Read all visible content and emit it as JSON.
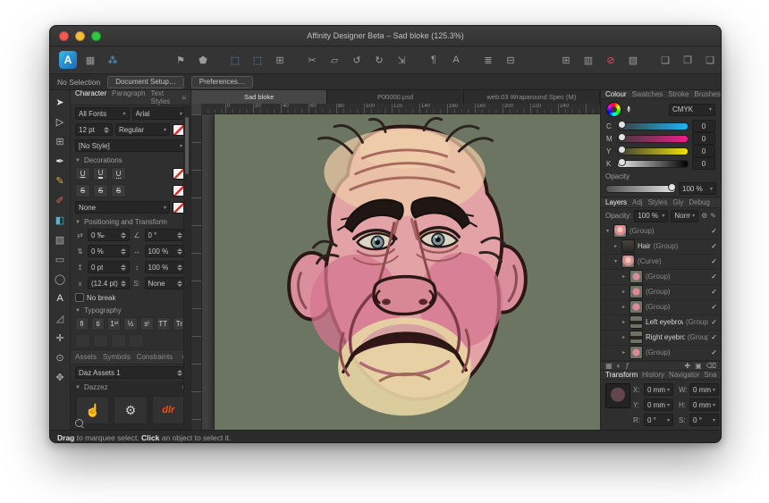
{
  "window": {
    "title": "Affinity Designer Beta – Sad bloke (125.3%)",
    "traffic": [
      "#f45c53",
      "#f6bd3b",
      "#2fc742"
    ]
  },
  "toolbar": {
    "groups": [
      {
        "icons": [
          {
            "name": "affinity-designer-logo",
            "glyph": "A",
            "logo": true
          },
          {
            "name": "pixel-persona-icon",
            "glyph": "▦",
            "color": "#9c9c9c"
          },
          {
            "name": "export-persona-icon",
            "glyph": "⁂",
            "color": "#57a8d8"
          }
        ]
      },
      {
        "icons": [
          {
            "name": "place-image-icon",
            "glyph": "⚑",
            "color": "#9c9c9c"
          },
          {
            "name": "shape-builder-icon",
            "glyph": "⬟",
            "color": "#9c9c9c"
          }
        ]
      },
      {
        "icons": [
          {
            "name": "marquee-select-icon",
            "glyph": "⬚",
            "color": "#6aa7e0"
          },
          {
            "name": "snap-to-grid-icon",
            "glyph": "⬚",
            "color": "#6aa7e0"
          },
          {
            "name": "grid-options-icon",
            "glyph": "⊞",
            "color": "#9c9c9c"
          }
        ]
      },
      {
        "icons": [
          {
            "name": "cut-icon",
            "glyph": "✂",
            "color": "#9c9c9c"
          },
          {
            "name": "duplicate-icon",
            "glyph": "▱",
            "color": "#9c9c9c"
          },
          {
            "name": "undo-icon",
            "glyph": "↺",
            "color": "#9c9c9c"
          },
          {
            "name": "redo-icon",
            "glyph": "↻",
            "color": "#9c9c9c"
          },
          {
            "name": "transform-icon",
            "glyph": "⇲",
            "color": "#9c9c9c"
          }
        ]
      },
      {
        "icons": [
          {
            "name": "paragraph-marks-icon",
            "glyph": "¶",
            "color": "#9c9c9c"
          },
          {
            "name": "character-traits-icon",
            "glyph": "A",
            "color": "#9c9c9c"
          }
        ]
      },
      {
        "icons": [
          {
            "name": "alignment-icon",
            "glyph": "≣",
            "color": "#9c9c9c"
          },
          {
            "name": "distribute-icon",
            "glyph": "⊟",
            "color": "#9c9c9c"
          }
        ]
      },
      {
        "icons": [
          {
            "name": "grid-icon",
            "glyph": "⊞",
            "color": "#9c9c9c"
          },
          {
            "name": "guides-icon",
            "glyph": "▥",
            "color": "#9c9c9c"
          },
          {
            "name": "snapping-icon",
            "glyph": "⊘",
            "color": "#e14b66"
          },
          {
            "name": "pixel-preview-icon",
            "glyph": "▧",
            "color": "#9c9c9c"
          }
        ]
      },
      {
        "icons": [
          {
            "name": "move-to-front-icon",
            "glyph": "❏",
            "color": "#9c9c9c"
          },
          {
            "name": "move-forward-icon",
            "glyph": "❐",
            "color": "#9c9c9c"
          },
          {
            "name": "move-backward-icon",
            "glyph": "❑",
            "color": "#9c9c9c"
          },
          {
            "name": "move-to-back-icon",
            "glyph": "❒",
            "color": "#9c9c9c"
          }
        ]
      },
      {
        "icons": [
          {
            "name": "insert-behind-icon",
            "glyph": "●",
            "color": "#3e8fe0"
          },
          {
            "name": "insert-inside-icon",
            "glyph": "●",
            "color": "#3e8fe0"
          },
          {
            "name": "assistant-icon",
            "glyph": "◐",
            "color": "#8f8f8f"
          }
        ]
      }
    ]
  },
  "context_bar": {
    "status": "No Selection",
    "document_setup": "Document Setup…",
    "preferences": "Preferences…"
  },
  "tools": [
    {
      "name": "move-tool",
      "glyph": "➤",
      "color": "#dcdcdc"
    },
    {
      "name": "node-tool",
      "glyph": "▷",
      "color": "#dcdcdc"
    },
    {
      "name": "artboard-tool",
      "glyph": "⊞",
      "color": "#ababab"
    },
    {
      "name": "pen-tool",
      "glyph": "✒",
      "color": "#e8e8e8"
    },
    {
      "name": "pencil-tool",
      "glyph": "✎",
      "color": "#e2a93c"
    },
    {
      "name": "vector-brush-tool",
      "glyph": "✐",
      "color": "#d8685a"
    },
    {
      "name": "fill-tool",
      "glyph": "◧",
      "color": "#54b6c6"
    },
    {
      "name": "transparency-tool",
      "glyph": "▨",
      "color": "#ababab"
    },
    {
      "name": "rectangle-tool",
      "glyph": "▭",
      "color": "#ababab"
    },
    {
      "name": "ellipse-tool",
      "glyph": "◯",
      "color": "#ababab"
    },
    {
      "name": "text-tool",
      "glyph": "A",
      "color": "#e2e2e2"
    },
    {
      "name": "corner-tool",
      "glyph": "◿",
      "color": "#ababab"
    },
    {
      "name": "colour-picker-tool",
      "glyph": "✛",
      "color": "#c8c8c8"
    },
    {
      "name": "zoom-tool",
      "glyph": "⊙",
      "color": "#ababab"
    },
    {
      "name": "view-tool",
      "glyph": "✥",
      "color": "#ababab"
    }
  ],
  "character_panel": {
    "tabs": [
      {
        "label": "Character",
        "active": true
      },
      {
        "label": "Paragraph",
        "active": false
      },
      {
        "label": "Text Styles",
        "active": false
      }
    ],
    "font_collection": "All Fonts",
    "font_family": "Arial",
    "font_size": "12 pt",
    "font_weight": "Regular",
    "text_style": "[No Style]",
    "decorations": {
      "title": "Decorations",
      "underline_buttons": [
        "U",
        "U",
        "U"
      ],
      "strike_buttons": [
        "S",
        "S",
        "S"
      ],
      "none": "None"
    },
    "positioning": {
      "title": "Positioning and Transform",
      "rows": [
        {
          "licon": "⇄",
          "a": "0 ‰",
          "ricon": "∠",
          "b": "0 °"
        },
        {
          "licon": "⇅",
          "a": "0 %",
          "ricon": "↔",
          "b": "100 %"
        },
        {
          "licon": "↥",
          "a": "0 pt",
          "ricon": "↕",
          "b": "100 %"
        },
        {
          "licon": "x",
          "a": "(12.4 pt)",
          "ricon": "S:",
          "b": "None"
        }
      ],
      "no_break": "No break"
    },
    "typography": {
      "title": "Typography",
      "buttons": [
        "fi",
        "ti",
        "1ˢᵗ",
        "½",
        "sᵗ",
        "TT",
        "Tr"
      ],
      "more_icons": [
        "typography-option-icon",
        "typography-option-icon",
        "typography-option-icon",
        "typography-option-icon"
      ]
    }
  },
  "assets_panel": {
    "tabs": [
      {
        "label": "Assets",
        "active": true
      },
      {
        "label": "Symbols",
        "active": false
      },
      {
        "label": "Constraints",
        "active": false
      }
    ],
    "collection": "Daz Assets 1",
    "section": "Dazzez",
    "tiles": [
      {
        "name": "hand-asset",
        "kind": "glyph",
        "glyph": "☝",
        "color": "#e8e8e8"
      },
      {
        "name": "gear-asset",
        "kind": "glyph",
        "glyph": "⚙",
        "color": "#cfcfcf"
      },
      {
        "name": "dlr-logo-asset",
        "kind": "text",
        "text": "dlr",
        "color": "#e8501e"
      },
      {
        "name": "red-label-asset",
        "kind": "block",
        "color": "#c81e1e"
      },
      {
        "name": "peace-hand-asset",
        "kind": "glyph",
        "glyph": "✌",
        "color": "#e87820"
      },
      {
        "name": "black-label-asset",
        "kind": "block",
        "color": "#141414"
      },
      {
        "name": "signature-asset-1",
        "kind": "script"
      },
      {
        "name": "signature-asset-2",
        "kind": "script"
      },
      {
        "name": "signature-asset-3",
        "kind": "script"
      }
    ]
  },
  "canvas": {
    "tabs": [
      {
        "label": "Sad bloke",
        "active": true
      },
      {
        "label": "P00000.psd",
        "active": false
      },
      {
        "label": "web:03 Wraparound Spec (M)",
        "active": false
      }
    ],
    "ruler_numbers": [
      "0",
      "20",
      "40",
      "60",
      "80",
      "100",
      "120",
      "140",
      "160",
      "180",
      "200",
      "220",
      "240"
    ]
  },
  "colour_panel": {
    "tabs": [
      {
        "label": "Colour",
        "active": true
      },
      {
        "label": "Swatches",
        "active": false
      },
      {
        "label": "Stroke",
        "active": false
      },
      {
        "label": "Brushes",
        "active": false
      }
    ],
    "mode": "CMYK",
    "sliders": [
      {
        "label": "C",
        "value": "0",
        "track": [
          "#3c3c3c",
          "#1fb6f0"
        ]
      },
      {
        "label": "M",
        "value": "0",
        "track": [
          "#3c3c3c",
          "#ec1e8c"
        ]
      },
      {
        "label": "Y",
        "value": "0",
        "track": [
          "#3c3c3c",
          "#f2e00a"
        ]
      },
      {
        "label": "K",
        "value": "0",
        "track": [
          "#ededed",
          "#000000"
        ]
      }
    ],
    "opacity_label": "Opacity",
    "opacity_value": "100 %"
  },
  "layers_panel": {
    "tabs": [
      {
        "label": "Layers",
        "active": true
      },
      {
        "label": "Adj",
        "active": false
      },
      {
        "label": "Styles",
        "active": false
      },
      {
        "label": "Gly",
        "active": false
      },
      {
        "label": "Debug",
        "active": false
      }
    ],
    "opacity_label": "Opacity:",
    "opacity_value": "100 %",
    "blend_mode": "Normal",
    "layers": [
      {
        "tri": "▾",
        "thumb": "face",
        "name": "",
        "kind": "(Group)",
        "indent": 0
      },
      {
        "tri": "▸",
        "thumb": "hair",
        "name": "Hair",
        "kind": "(Group)",
        "indent": 1
      },
      {
        "tri": "▾",
        "thumb": "face",
        "name": "",
        "kind": "(Curve)",
        "indent": 1
      },
      {
        "tri": "▸",
        "thumb": "part",
        "name": "",
        "kind": "(Group)",
        "indent": 2
      },
      {
        "tri": "▸",
        "thumb": "part",
        "name": "",
        "kind": "(Group)",
        "indent": 2
      },
      {
        "tri": "▸",
        "thumb": "part",
        "name": "",
        "kind": "(Group)",
        "indent": 2
      },
      {
        "tri": "▸",
        "thumb": "brow",
        "name": "Left eyebrow",
        "kind": "(Group)",
        "indent": 2
      },
      {
        "tri": "▸",
        "thumb": "brow",
        "name": "Right eyebrow",
        "kind": "(Group)",
        "indent": 2
      },
      {
        "tri": "▸",
        "thumb": "part",
        "name": "",
        "kind": "(Group)",
        "indent": 2
      }
    ],
    "check_glyph": "✓",
    "bottom_left_icons": [
      {
        "name": "blend-ranges-icon",
        "glyph": "▦"
      },
      {
        "name": "mask-layer-icon",
        "glyph": "◐"
      },
      {
        "name": "layer-effects-icon",
        "glyph": "ƒ"
      }
    ],
    "bottom_right_icons": [
      {
        "name": "add-layer-icon",
        "glyph": "✚"
      },
      {
        "name": "new-group-icon",
        "glyph": "▣"
      },
      {
        "name": "delete-layer-icon",
        "glyph": "⌫"
      }
    ]
  },
  "transform_panel": {
    "tabs": [
      {
        "label": "Transform",
        "active": true
      },
      {
        "label": "History",
        "active": false
      },
      {
        "label": "Navigator",
        "active": false
      },
      {
        "label": "Snapshots",
        "active": false
      }
    ],
    "fields": [
      {
        "label": "X:",
        "value": "0 mm"
      },
      {
        "label": "W:",
        "value": "0 mm"
      },
      {
        "label": "Y:",
        "value": "0 mm"
      },
      {
        "label": "H:",
        "value": "0 mm"
      },
      {
        "label": "R:",
        "value": "0 °"
      },
      {
        "label": "S:",
        "value": "0 °"
      }
    ]
  },
  "status_bar": {
    "drag": "Drag",
    "mid": " to marquee select. ",
    "click": "Click",
    "end": " an object to select it."
  }
}
